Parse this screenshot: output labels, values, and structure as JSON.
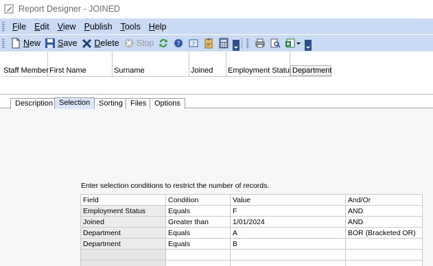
{
  "window": {
    "title": "Report Designer - JOINED"
  },
  "menu": {
    "items": [
      {
        "key": "F",
        "rest": "ile"
      },
      {
        "key": "E",
        "rest": "dit"
      },
      {
        "key": "V",
        "rest": "iew"
      },
      {
        "key": "P",
        "rest": "ublish"
      },
      {
        "key": "T",
        "rest": "ools"
      },
      {
        "key": "H",
        "rest": "elp"
      }
    ]
  },
  "toolbar": {
    "new_key": "N",
    "new_rest": "ew",
    "save_key": "S",
    "save_rest": "ave",
    "delete_key": "D",
    "delete_rest": "elete",
    "stop_label": "Stop"
  },
  "preview": {
    "columns": [
      "Staff Member",
      "First Name",
      "Surname",
      "Joined",
      "Employment Status",
      "Department"
    ]
  },
  "tabs": [
    "Description",
    "Selection",
    "Sorting",
    "Files",
    "Options"
  ],
  "active_tab": "Selection",
  "selection": {
    "instruction": "Enter selection conditions to restrict the number of records.",
    "headers": [
      "Field",
      "Condition",
      "Value",
      "And/Or"
    ],
    "rows": [
      [
        "Employment Status",
        "Equals",
        "F",
        "AND"
      ],
      [
        "Joined",
        "Greater than",
        "1/01/2024",
        "AND"
      ],
      [
        "Department",
        "Equals",
        "A",
        "BOR (Bracketed OR)"
      ],
      [
        "Department",
        "Equals",
        "B",
        ""
      ]
    ]
  },
  "colors": {
    "toolbar_bg": "#c9daf5",
    "active_tab_bg": "#dbe7f8"
  }
}
